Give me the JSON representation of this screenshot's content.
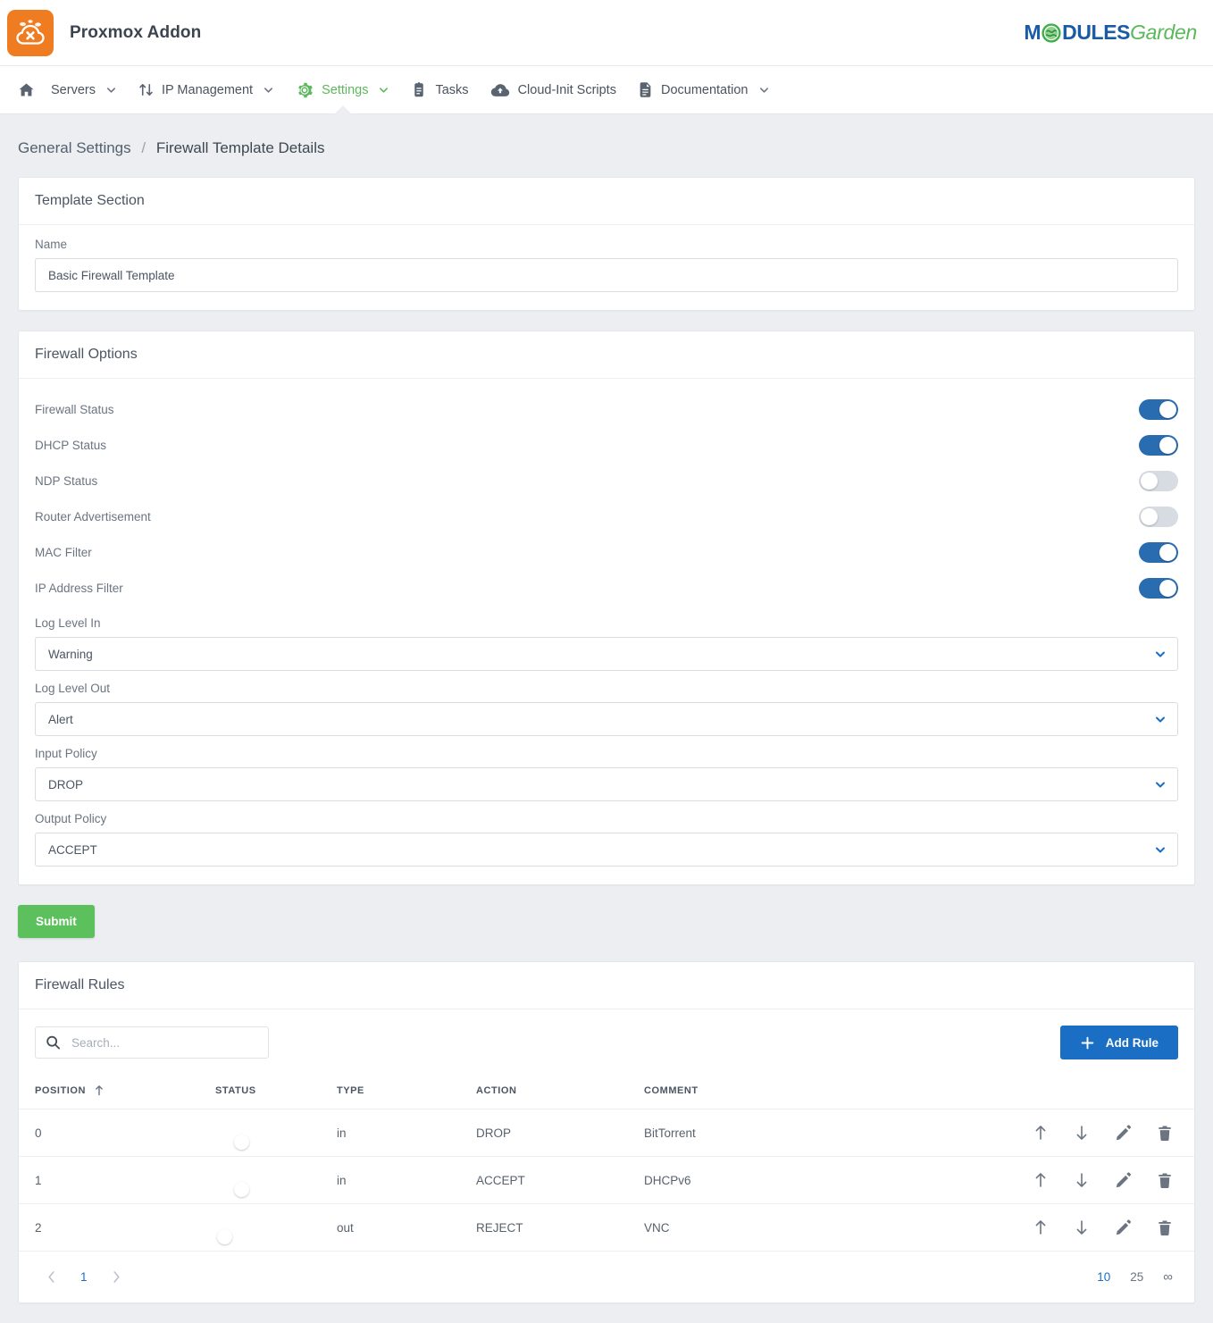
{
  "header": {
    "app_title": "Proxmox Addon",
    "logo_icon": "proxmox-cloud-icon",
    "vendor_logo": {
      "word_part1": "M",
      "word_part2": "DULES",
      "word_part3": "Garden",
      "globe_icon": "globe-icon"
    }
  },
  "nav": {
    "items": [
      {
        "label": "",
        "icon": "home-icon",
        "caret": false,
        "active": false,
        "name": "home"
      },
      {
        "label": "Servers",
        "icon": "server-icon",
        "caret": true,
        "active": false,
        "name": "servers"
      },
      {
        "label": "IP Management",
        "icon": "sort-arrows-icon",
        "caret": true,
        "active": false,
        "name": "ip-management"
      },
      {
        "label": "Settings",
        "icon": "gear-icon",
        "caret": true,
        "active": true,
        "name": "settings"
      },
      {
        "label": "Tasks",
        "icon": "clipboard-icon",
        "caret": false,
        "active": false,
        "name": "tasks"
      },
      {
        "label": "Cloud-Init Scripts",
        "icon": "cloud-upload-icon",
        "caret": false,
        "active": false,
        "name": "cloud-init-scripts"
      },
      {
        "label": "Documentation",
        "icon": "document-icon",
        "caret": true,
        "active": false,
        "name": "documentation"
      }
    ]
  },
  "breadcrumb": {
    "parent": "General Settings",
    "separator": "/",
    "current": "Firewall Template Details"
  },
  "template_section": {
    "title": "Template Section",
    "name_label": "Name",
    "name_value": "Basic Firewall Template",
    "name_placeholder": ""
  },
  "firewall_options": {
    "title": "Firewall Options",
    "toggles": [
      {
        "label": "Firewall Status",
        "on": true
      },
      {
        "label": "DHCP Status",
        "on": true
      },
      {
        "label": "NDP Status",
        "on": false
      },
      {
        "label": "Router Advertisement",
        "on": false
      },
      {
        "label": "MAC Filter",
        "on": true
      },
      {
        "label": "IP Address Filter",
        "on": true
      }
    ],
    "selects": [
      {
        "label": "Log Level In",
        "value": "Warning"
      },
      {
        "label": "Log Level Out",
        "value": "Alert"
      },
      {
        "label": "Input Policy",
        "value": "DROP"
      },
      {
        "label": "Output Policy",
        "value": "ACCEPT"
      }
    ]
  },
  "submit_label": "Submit",
  "firewall_rules": {
    "title": "Firewall Rules",
    "search_placeholder": "Search...",
    "search_value": "",
    "add_rule_label": "Add Rule",
    "columns": [
      "POSITION",
      "STATUS",
      "TYPE",
      "ACTION",
      "COMMENT"
    ],
    "sort_column": "POSITION",
    "sort_direction": "asc",
    "rows": [
      {
        "position": "0",
        "status_on": true,
        "type": "in",
        "action": "DROP",
        "comment": "BitTorrent"
      },
      {
        "position": "1",
        "status_on": true,
        "type": "in",
        "action": "ACCEPT",
        "comment": "DHCPv6"
      },
      {
        "position": "2",
        "status_on": false,
        "type": "out",
        "action": "REJECT",
        "comment": "VNC"
      }
    ],
    "row_tools": [
      "move-up-icon",
      "move-down-icon",
      "edit-icon",
      "delete-icon"
    ],
    "pagination": {
      "prev": "‹",
      "next": "›",
      "current_page": "1",
      "page_sizes": [
        "10",
        "25",
        "∞"
      ],
      "active_page_size": "10"
    }
  },
  "colors": {
    "accent_blue": "#1a6fc4",
    "toggle_on": "#2a6cb0",
    "toggle_off": "#d7dbe2",
    "submit_green": "#5cc15c",
    "nav_active_green": "#5cb85c",
    "logo_orange": "#f07c21",
    "page_bg": "#eceef1"
  }
}
